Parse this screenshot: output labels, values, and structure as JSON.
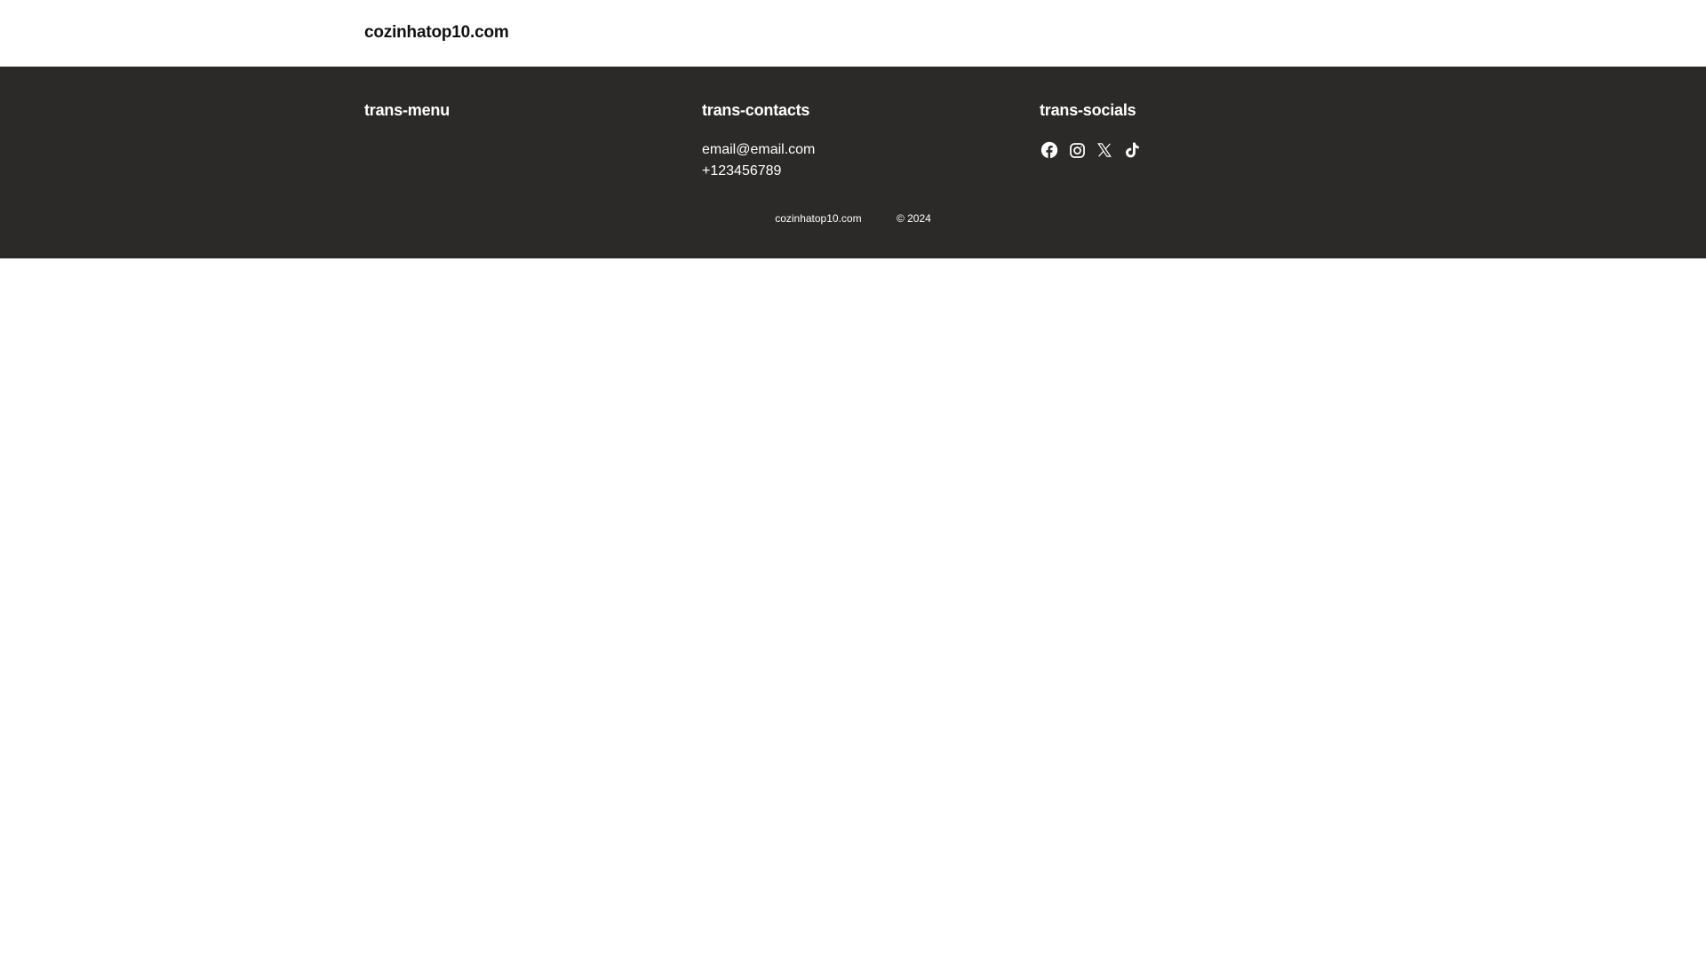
{
  "header": {
    "site_title": "cozinhatop10.com"
  },
  "footer": {
    "menu_heading": "trans-menu",
    "contacts_heading": "trans-contacts",
    "socials_heading": "trans-socials",
    "email": "email@email.com",
    "phone": "+123456789",
    "socials": [
      {
        "icon": "facebook-icon"
      },
      {
        "icon": "instagram-icon"
      },
      {
        "icon": "x-twitter-icon"
      },
      {
        "icon": "tiktok-icon"
      }
    ],
    "bottom_site": "cozinhatop10.com",
    "copyright": "© 2024"
  },
  "colors": {
    "footer_bg": "#2c2a29",
    "footer_text": "#ffffff",
    "header_text": "#111111"
  }
}
